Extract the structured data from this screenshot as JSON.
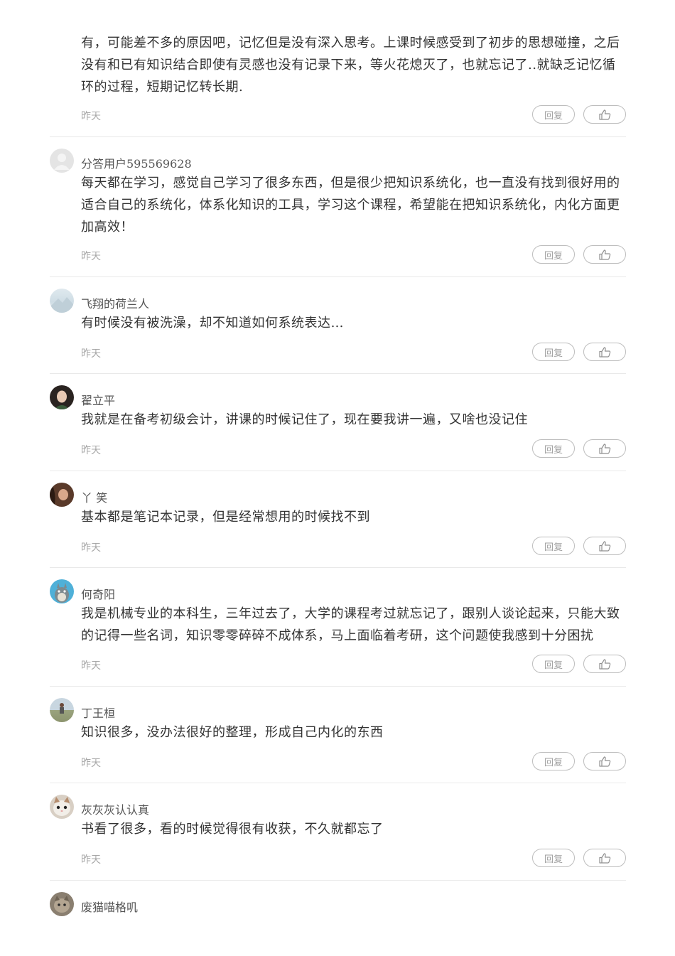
{
  "labels": {
    "reply": "回复"
  },
  "comments": [
    {
      "username": "",
      "content": "有，可能差不多的原因吧，记忆但是没有深入思考。上课时候感受到了初步的思想碰撞，之后没有和已有知识结合即使有灵感也没有记录下来，等火花熄灭了，也就忘记了..就缺乏记忆循环的过程，短期记忆转长期.",
      "time": "昨天"
    },
    {
      "username": "分答用户595569628",
      "content": "每天都在学习，感觉自己学习了很多东西，但是很少把知识系统化，也一直没有找到很好用的适合自己的系统化，体系化知识的工具，学习这个课程，希望能在把知识系统化，内化方面更加高效！",
      "time": "昨天",
      "avatar": "default-avatar"
    },
    {
      "username": "飞翔的荷兰人",
      "content": "有时候没有被洗澡，却不知道如何系统表达…",
      "time": "昨天",
      "avatar": "landscape-avatar"
    },
    {
      "username": "翟立平",
      "content": "我就是在备考初级会计，讲课的时候记住了，现在要我讲一遍，又啥也没记住",
      "time": "昨天",
      "avatar": "portrait-avatar"
    },
    {
      "username": "丫 笑",
      "content": "基本都是笔记本记录，但是经常想用的时候找不到",
      "time": "昨天",
      "avatar": "portrait-avatar"
    },
    {
      "username": "何奇阳",
      "content": "我是机械专业的本科生，三年过去了，大学的课程考过就忘记了，跟别人谈论起来，只能大致的记得一些名词，知识零零碎碎不成体系，马上面临着考研，这个问题使我感到十分困扰",
      "time": "昨天",
      "avatar": "totoro-avatar"
    },
    {
      "username": "丁王桓",
      "content": "知识很多，没办法很好的整理，形成自己内化的东西",
      "time": "昨天",
      "avatar": "outdoor-avatar"
    },
    {
      "username": "灰灰灰认认真",
      "content": "书看了很多，看的时候觉得很有收获，不久就都忘了",
      "time": "昨天",
      "avatar": "cat-avatar"
    },
    {
      "username": "废猫喵格叽",
      "content": "",
      "time": "",
      "avatar": "cat-avatar"
    }
  ]
}
